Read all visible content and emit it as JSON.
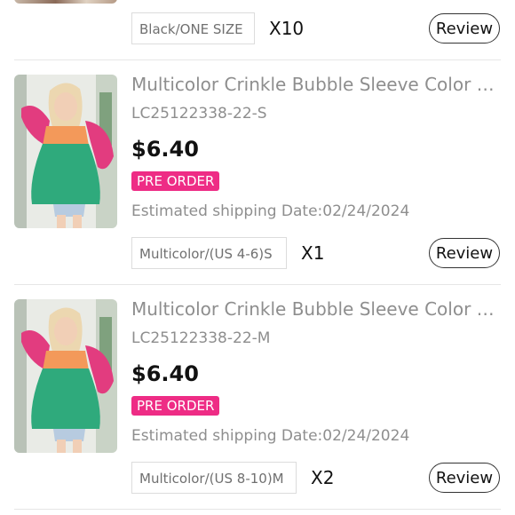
{
  "top_row": {
    "variant": "Black/ONE SIZE",
    "quantity": "X10",
    "review_label": "Review"
  },
  "items": [
    {
      "title": "Multicolor Crinkle Bubble Sleeve Color Block Babydoll Top",
      "sku": "LC25122338-22-S",
      "price": "$6.40",
      "badge": "PRE ORDER",
      "shipping": "Estimated shipping Date:02/24/2024",
      "variant": "Multicolor/(US 4-6)S",
      "quantity": "X1",
      "review_label": "Review"
    },
    {
      "title": "Multicolor Crinkle Bubble Sleeve Color Block Babydoll Top",
      "sku": "LC25122338-22-M",
      "price": "$6.40",
      "badge": "PRE ORDER",
      "shipping": "Estimated shipping Date:02/24/2024",
      "variant": "Multicolor/(US 8-10)M",
      "quantity": "X2",
      "review_label": "Review"
    }
  ],
  "colors": {
    "badge": "#ee2c85",
    "muted_text": "#8e8e8e",
    "price": "#111111"
  }
}
